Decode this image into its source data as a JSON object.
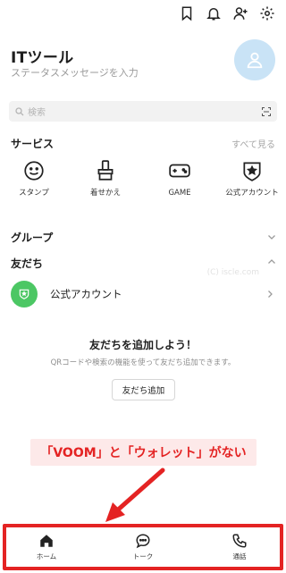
{
  "header": {
    "icons": [
      "bookmark-icon",
      "bell-icon",
      "add-friend-icon",
      "settings-icon"
    ]
  },
  "profile": {
    "name": "ITツール",
    "status_placeholder": "ステータスメッセージを入力"
  },
  "search": {
    "placeholder": "検索"
  },
  "services": {
    "title": "サービス",
    "see_all": "すべて見る",
    "items": [
      {
        "label": "スタンプ",
        "icon": "smiley-icon"
      },
      {
        "label": "着せかえ",
        "icon": "brush-icon"
      },
      {
        "label": "GAME",
        "icon": "game-controller-icon"
      },
      {
        "label": "公式アカウント",
        "icon": "official-badge-icon"
      }
    ]
  },
  "groups": {
    "title": "グループ"
  },
  "friends": {
    "title": "友だち",
    "official_account": "公式アカウント",
    "watermark": "(C) iscle.com"
  },
  "empty": {
    "title": "友だちを追加しよう！",
    "subtitle": "QRコードや検索の機能を使って友だち追加できます。",
    "button": "友だち追加"
  },
  "annotation": {
    "text": "「VOOM」と「ウォレット」がない"
  },
  "tabs": [
    {
      "label": "ホーム",
      "icon": "home-icon"
    },
    {
      "label": "トーク",
      "icon": "chat-icon"
    },
    {
      "label": "通話",
      "icon": "phone-icon"
    }
  ],
  "colors": {
    "accent": "#4cc764",
    "annotation_red": "#e42323",
    "avatar_bg": "#c9e3f6"
  }
}
